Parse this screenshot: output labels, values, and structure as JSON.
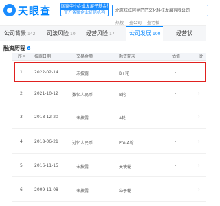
{
  "header": {
    "logo_text": "天眼查",
    "banner_line1": "国家中小企业发展子基金旗下",
    "banner_line2": "官方备案企业征信机构",
    "search_value": "北京炫红阿里巴巴文化科技发展有限公司",
    "sublinks": [
      "热搜",
      "查公司",
      "查老板"
    ]
  },
  "tabs": [
    {
      "label": "公司背景",
      "count": "142"
    },
    {
      "label": "司法风险",
      "count": "10"
    },
    {
      "label": "经营风险",
      "count": "17"
    },
    {
      "label": "公司发展",
      "count": "100"
    },
    {
      "label": "经营状",
      "count": ""
    }
  ],
  "section": {
    "title": "融资历程",
    "count": "6"
  },
  "table": {
    "headers": [
      "序号",
      "披露日期",
      "交易金额",
      "融资轮次",
      "估值",
      "比"
    ],
    "rows": [
      {
        "index": "1",
        "date": "2022-02-14",
        "amount": "未披露",
        "round": "B+轮",
        "valuation": "-"
      },
      {
        "index": "2",
        "date": "2021-10-12",
        "amount": "数亿人民币",
        "round": "B轮",
        "valuation": "-"
      },
      {
        "index": "3",
        "date": "2018-12-20",
        "amount": "未披露",
        "round": "A轮",
        "valuation": "-"
      },
      {
        "index": "4",
        "date": "2018-06-21",
        "amount": "过亿人民币",
        "round": "Pre-A轮",
        "valuation": "-"
      },
      {
        "index": "5",
        "date": "2016-11-15",
        "amount": "未披露",
        "round": "天使轮",
        "valuation": "-"
      },
      {
        "index": "6",
        "date": "2009-11-08",
        "amount": "未披露",
        "round": "种子轮",
        "valuation": "-"
      }
    ]
  },
  "colors": {
    "accent": "#0084ff",
    "highlight_border": "#e0211f"
  }
}
